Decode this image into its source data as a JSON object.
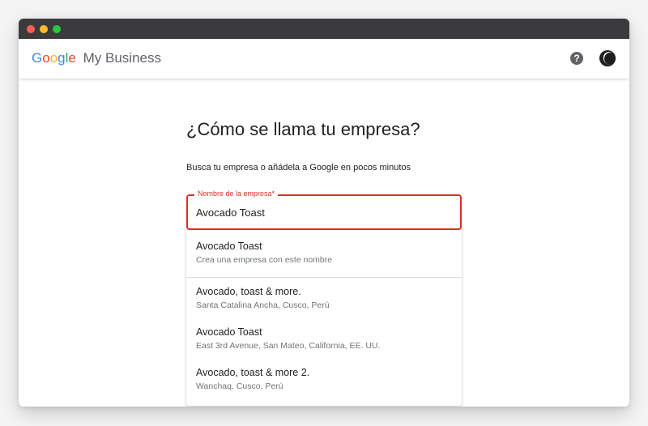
{
  "header": {
    "logo_google_letters": [
      "G",
      "o",
      "o",
      "g",
      "l",
      "e"
    ],
    "logo_colors": [
      "#4285F4",
      "#EA4335",
      "#FBBC05",
      "#4285F4",
      "#34A853",
      "#EA4335"
    ],
    "product_name": "My Business",
    "help_icon": "help-icon",
    "help_glyph": "?",
    "avatar_icon": "avatar"
  },
  "main": {
    "title": "¿Cómo se llama tu empresa?",
    "subtitle": "Busca tu empresa o añádela a Google en pocos minutos",
    "field": {
      "label": "Nombre de la empresa*",
      "value": "Avocado Toast",
      "error_color": "#d93025"
    },
    "suggestions": [
      {
        "name": "Avocado Toast",
        "description": "Crea una empresa con este nombre"
      },
      {
        "name": "Avocado, toast & more.",
        "description": "Santa Catalina Ancha, Cusco, Perú"
      },
      {
        "name": "Avocado Toast",
        "description": "East 3rd Avenue, San Mateo, California, EE. UU."
      },
      {
        "name": "Avocado, toast & more 2.",
        "description": "Wanchaq, Cusco, Perú"
      }
    ]
  }
}
